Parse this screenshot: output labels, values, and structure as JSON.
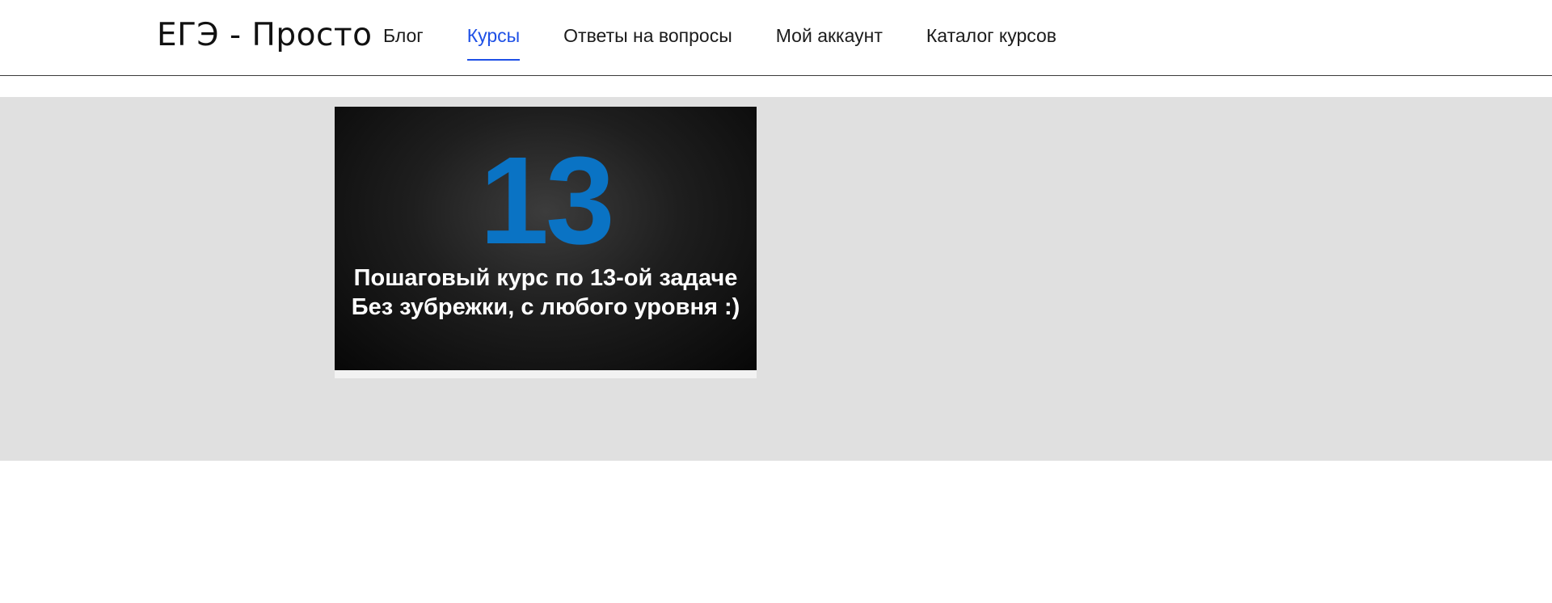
{
  "header": {
    "logo": "ЕГЭ - Просто",
    "nav": [
      {
        "label": "Блог",
        "active": false
      },
      {
        "label": "Курсы",
        "active": true
      },
      {
        "label": "Ответы на вопросы",
        "active": false
      },
      {
        "label": "Мой аккаунт",
        "active": false
      },
      {
        "label": "Каталог курсов",
        "active": false
      }
    ]
  },
  "courses": [
    {
      "cover_number": "13",
      "cover_line1": "Пошаговый курс по 13-ой задаче",
      "cover_line2": "Без зубрежки, с любого уровня :)"
    }
  ],
  "colors": {
    "accent": "#1e50e6",
    "cover_number": "#0a73c4",
    "content_bg": "#e0e0e0"
  }
}
